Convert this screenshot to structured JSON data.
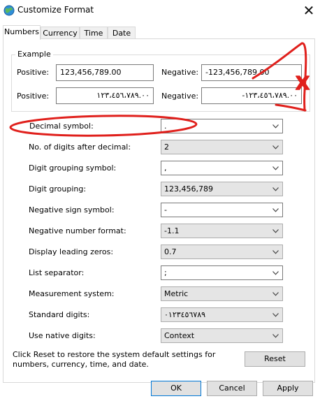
{
  "window": {
    "title": "Customize Format",
    "close_glyph": "✕"
  },
  "tabs": [
    {
      "label": "Numbers",
      "active": true
    },
    {
      "label": "Currency",
      "active": false
    },
    {
      "label": "Time",
      "active": false
    },
    {
      "label": "Date",
      "active": false
    }
  ],
  "example": {
    "group_label": "Example",
    "rows": [
      {
        "positive_label": "Positive:",
        "positive_value": "123,456,789.00",
        "negative_label": "Negative:",
        "negative_value": "-123,456,789.00"
      },
      {
        "positive_label": "Positive:",
        "positive_value": "١٢٣،٤٥٦،٧٨٩.٠٠",
        "negative_label": "Negative:",
        "negative_value": "-١٢٣،٤٥٦،٧٨٩.٠٠"
      }
    ]
  },
  "settings": [
    {
      "label": "Decimal symbol:",
      "value": ".",
      "kind": "edit"
    },
    {
      "label": "No. of digits after decimal:",
      "value": "2",
      "kind": "list"
    },
    {
      "label": "Digit grouping symbol:",
      "value": ",",
      "kind": "edit"
    },
    {
      "label": "Digit grouping:",
      "value": "123,456,789",
      "kind": "list"
    },
    {
      "label": "Negative sign symbol:",
      "value": "-",
      "kind": "edit"
    },
    {
      "label": "Negative number format:",
      "value": "-1.1",
      "kind": "list"
    },
    {
      "label": "Display leading zeros:",
      "value": "0.7",
      "kind": "list"
    },
    {
      "label": "List separator:",
      "value": ";",
      "kind": "edit"
    },
    {
      "label": "Measurement system:",
      "value": "Metric",
      "kind": "list"
    },
    {
      "label": "Standard digits:",
      "value": "٠١٢٣٤٥٦٧٨٩",
      "kind": "list"
    },
    {
      "label": "Use native digits:",
      "value": "Context",
      "kind": "list"
    }
  ],
  "reset_note": "Click Reset to restore the system default settings for numbers, currency, time, and date.",
  "buttons": {
    "reset": "Reset",
    "ok": "OK",
    "cancel": "Cancel",
    "apply": "Apply"
  },
  "annotation": {
    "color": "#e0201c",
    "mark": "X"
  },
  "colors": {
    "accent": "#0078d7",
    "list_combo_bg": "#e5e5e5",
    "button_bg": "#e1e1e1"
  }
}
